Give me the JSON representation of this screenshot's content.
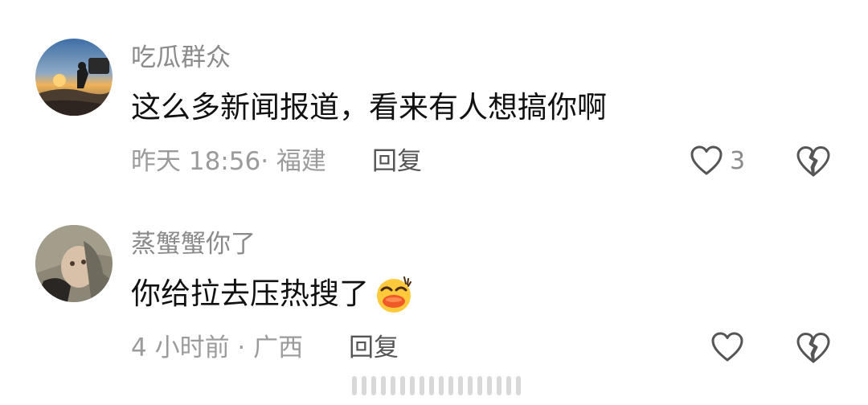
{
  "comments": [
    {
      "username": "吃瓜群众",
      "text": "这么多新闻报道，看来有人想搞你啊",
      "meta": "昨天 18:56· 福建",
      "reply_label": "回复",
      "like_count": "3",
      "avatar_icon": "avatar-sunset-person"
    },
    {
      "username": "蒸蟹蟹你了",
      "text": "你给拉去压热搜了",
      "emoji": "grinning-duck-emoji",
      "meta": "4 小时前 · 广西",
      "reply_label": "回复",
      "like_count": "",
      "avatar_icon": "avatar-photo"
    }
  ],
  "icons": {
    "like": "heart-outline-icon",
    "dislike": "broken-heart-icon"
  },
  "colors": {
    "username": "#8a8a8a",
    "text": "#111111",
    "meta": "#9b9b9b",
    "reply": "#555555",
    "icon": "#555555"
  }
}
